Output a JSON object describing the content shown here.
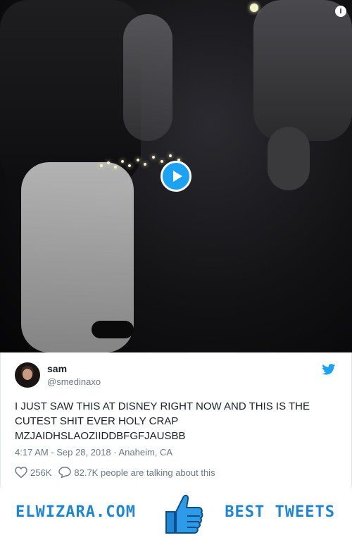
{
  "video": {
    "info_label": "i"
  },
  "tweet": {
    "display_name": "sam",
    "handle": "@smedinaxo",
    "text": "I JUST SAW THIS AT DISNEY RIGHT NOW AND THIS IS THE CUTEST SHIT EVER HOLY CRAP MZJAIDHSLAOZIIDDBFGFJAUSBB",
    "time": "4:17 AM - Sep 28, 2018",
    "separator": "·",
    "location": "Anaheim, CA",
    "likes": "256K",
    "replies_text": "82.7K people are talking about this"
  },
  "colors": {
    "accent": "#1da1f2",
    "banner_text": "#1f86d6",
    "muted": "#697882"
  },
  "icons": {
    "info": "info-icon",
    "play": "play-icon",
    "twitter": "twitter-bird-icon",
    "like": "heart-icon",
    "reply": "speech-bubble-icon",
    "thumb": "thumbs-up-icon"
  },
  "banner": {
    "left_text": "ELWIZARA.COM",
    "right_text": "BEST TWEETS"
  }
}
